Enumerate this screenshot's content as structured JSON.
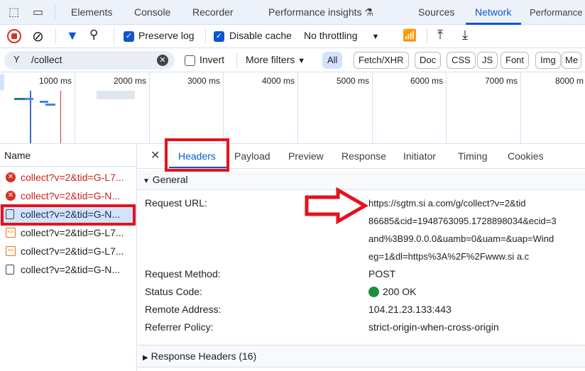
{
  "main_tabs": [
    "Elements",
    "Console",
    "Recorder",
    "Performance insights",
    "Sources",
    "Network",
    "Performance"
  ],
  "toolbar": {
    "preserve_log": "Preserve log",
    "preserve_log_checked": true,
    "disable_cache": "Disable cache",
    "disable_cache_checked": true,
    "throttling": "No throttling"
  },
  "filter": {
    "value": "/collect",
    "invert": "Invert",
    "invert_checked": false,
    "more_filters": "More filters",
    "types": [
      "All",
      "Fetch/XHR",
      "Doc",
      "CSS",
      "JS",
      "Font",
      "Img",
      "Me"
    ]
  },
  "timeline": {
    "ticks": [
      "1000 ms",
      "2000 ms",
      "3000 ms",
      "4000 ms",
      "5000 ms",
      "6000 ms",
      "7000 ms",
      "8000 m"
    ]
  },
  "requests": {
    "header": "Name",
    "rows": [
      {
        "name": "collect?v=2&tid=G-L7...",
        "status": "error"
      },
      {
        "name": "collect?v=2&tid=G-N...",
        "status": "error"
      },
      {
        "name": "collect?v=2&tid=G-N...",
        "status": "document",
        "selected": true
      },
      {
        "name": "collect?v=2&tid=G-L7...",
        "status": "script"
      },
      {
        "name": "collect?v=2&tid=G-L7...",
        "status": "script"
      },
      {
        "name": "collect?v=2&tid=G-N...",
        "status": "document"
      }
    ]
  },
  "details": {
    "tabs": [
      "Headers",
      "Payload",
      "Preview",
      "Response",
      "Initiator",
      "Timing",
      "Cookies"
    ],
    "active_tab": "Headers",
    "general": "General",
    "request_url_label": "Request URL:",
    "request_url_lines": [
      "https://sgtm.si                     a.com/g/collect?v=2&tid",
      "86685&cid=1948763095.1728898034&ecid=3",
      "and%3B99.0.0.0&uamb=0&uam=&uap=Wind",
      "eg=1&dl=https%3A%2F%2Fwww.si                a.c"
    ],
    "request_method_label": "Request Method:",
    "request_method": "POST",
    "status_code_label": "Status Code:",
    "status_code": "200 OK",
    "status_color": "#1e8e3e",
    "remote_address_label": "Remote Address:",
    "remote_address": "104.21.23.133:443",
    "referrer_policy_label": "Referrer Policy:",
    "referrer_policy": "strict-origin-when-cross-origin",
    "response_headers": "Response Headers (16)"
  },
  "colors": {
    "accent": "#0b57d0",
    "annotation": "#e3131b",
    "error": "#c5221f"
  }
}
